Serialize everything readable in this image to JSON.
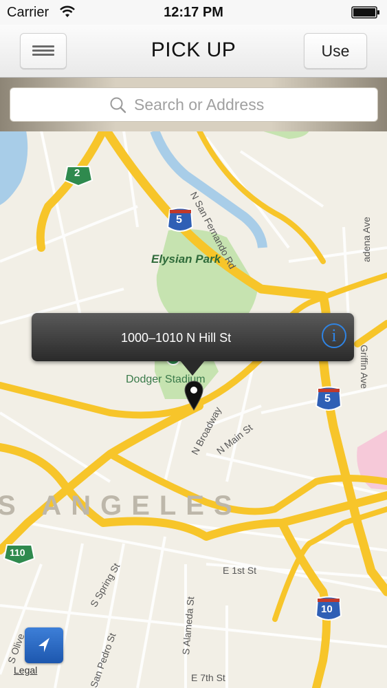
{
  "status_bar": {
    "carrier": "Carrier",
    "time": "12:17 PM"
  },
  "nav": {
    "title": "PICK UP",
    "use_label": "Use"
  },
  "search": {
    "placeholder": "Search or Address"
  },
  "map": {
    "labels": {
      "elysian_park": "Elysian Park",
      "dodger_stadium": "Dodger Stadium",
      "los_angeles": "S ANGELES",
      "n_san_fernando_rd": "N San Fernando Rd",
      "pasadena_ave": "adena Ave",
      "griffin_ave": "Griffin Ave",
      "n_broadway": "N Broadway",
      "n_main_st": "N Main St",
      "e_1st_st": "E 1st St",
      "s_spring_st": "S Spring St",
      "s_alameda_st": "S Alameda St",
      "s_pedro_st": "San Pedro St",
      "s_olive": "S Olive",
      "e_7th_st": "E 7th St"
    },
    "shields": {
      "ca2": "2",
      "i5_top": "5",
      "i5_right": "5",
      "ca110": "110",
      "i10": "10"
    }
  },
  "callout": {
    "address": "1000–1010 N Hill St",
    "info_glyph": "i"
  },
  "legal": "Legal",
  "colors": {
    "highway": "#f7c52a",
    "park": "#c6e3b0",
    "water": "#a8cde8",
    "map_bg": "#f2efe6",
    "info_blue": "#2f84e4"
  }
}
